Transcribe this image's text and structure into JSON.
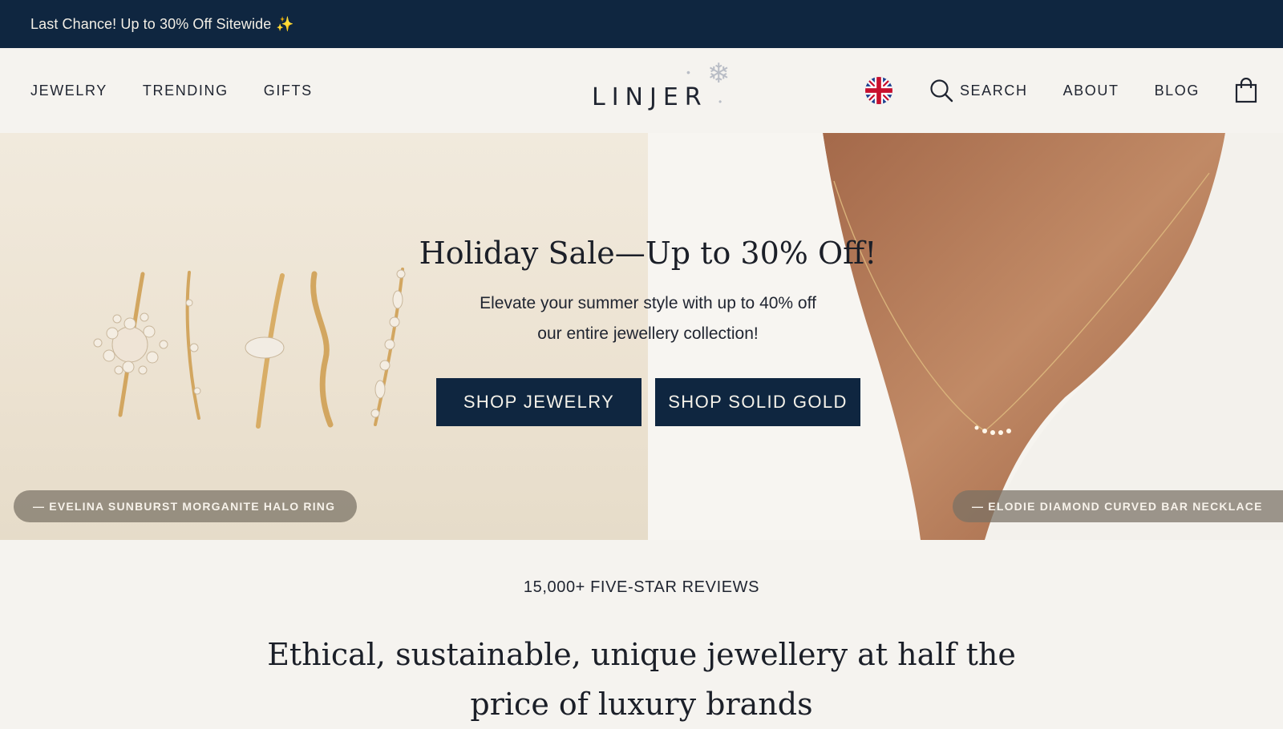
{
  "announcement": {
    "text": "Last Chance! Up to 30% Off Sitewide",
    "sparkle_icon": "sparkle-icon"
  },
  "nav": {
    "left": [
      {
        "label": "JEWELRY"
      },
      {
        "label": "TRENDING"
      },
      {
        "label": "GIFTS"
      }
    ],
    "logo": "LINJER",
    "flag_icon": "uk-flag-icon",
    "search_label": "SEARCH",
    "about_label": "ABOUT",
    "blog_label": "BLOG",
    "bag_icon": "shopping-bag-icon"
  },
  "hero": {
    "title": "Holiday Sale—Up to 30% Off!",
    "subtitle_line1": "Elevate your summer style with up to 40% off",
    "subtitle_line2": "our entire jewellery collection!",
    "btn_jewelry": "SHOP JEWELRY",
    "btn_gold": "SHOP SOLID GOLD",
    "left_caption": "— EVELINA SUNBURST MORGANITE HALO RING",
    "right_caption": "— ELODIE DIAMOND CURVED BAR NECKLACE"
  },
  "reviews": "15,000+ FIVE-STAR REVIEWS",
  "tagline_line1": "Ethical, sustainable, unique jewellery at half the",
  "tagline_line2": "price of luxury brands",
  "colors": {
    "navy": "#0f2640",
    "background": "#f5f3ef",
    "gold": "#d2a660"
  }
}
